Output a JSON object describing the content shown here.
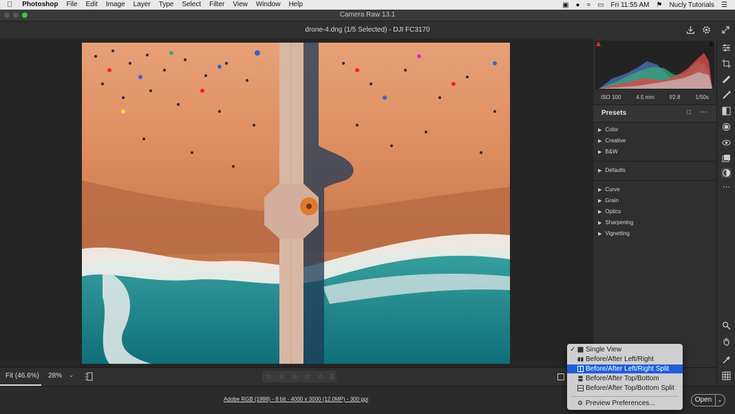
{
  "menubar": {
    "app": "Photoshop",
    "items": [
      "File",
      "Edit",
      "Image",
      "Layer",
      "Type",
      "Select",
      "Filter",
      "View",
      "Window",
      "Help"
    ],
    "clock": "Fri 11:55 AM",
    "user": "Nucly Tutorials"
  },
  "window": {
    "title": "Camera Raw 13.1"
  },
  "file": {
    "name": "drone-4.dng (1/5 Selected)  -  DJI FC3170"
  },
  "exif": {
    "iso": "ISO 100",
    "focal": "4.5 mm",
    "aperture": "f/2.8",
    "shutter": "1/50s"
  },
  "presets": {
    "title": "Presets",
    "groups1": [
      "Color",
      "Creative",
      "B&W"
    ],
    "groups2": [
      "Defaults"
    ],
    "groups3": [
      "Curve",
      "Grain",
      "Optics",
      "Sharpening",
      "Vignetting"
    ]
  },
  "zoom": {
    "fit": "Fit (46.6%)",
    "percent": "28%"
  },
  "status": {
    "info": "Adobe RGB (1998) - 8 bit - 4000 x 3000 (12.0MP) - 300 ppi"
  },
  "open_label": "Open",
  "view_menu": {
    "items": [
      {
        "label": "Single View",
        "checked": true
      },
      {
        "label": "Before/After Left/Right"
      },
      {
        "label": "Before/After Left/Right Split",
        "selected": true
      },
      {
        "label": "Before/After Top/Bottom"
      },
      {
        "label": "Before/After Top/Bottom Split"
      }
    ],
    "preferences": "Preview Preferences..."
  },
  "colors": {
    "menu_highlight": "#1f5fd6",
    "panel": "#2f2f2f",
    "canvas": "#252525"
  }
}
